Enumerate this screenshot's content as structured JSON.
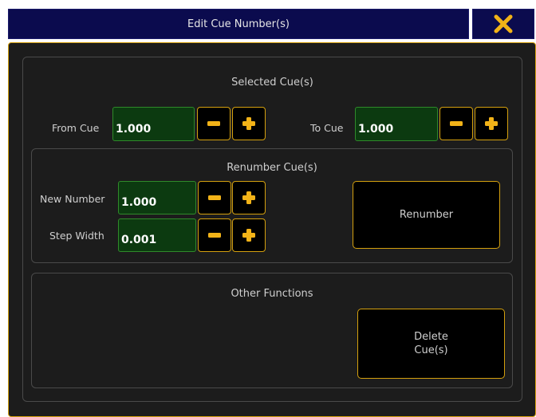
{
  "title": "Edit Cue Number(s)",
  "close_icon": "close-x-icon",
  "colors": {
    "title_bar": "#0b0b4e",
    "dialog_bg": "#1c1c1c",
    "accent": "#d4a00e",
    "field_bg": "#0c3a10",
    "field_border": "#2f8a2a"
  },
  "selected": {
    "title": "Selected Cue(s)",
    "from_label": "From Cue",
    "from_value": "1.000",
    "to_label": "To Cue",
    "to_value": "1.000"
  },
  "renumber": {
    "title": "Renumber Cue(s)",
    "new_number_label": "New Number",
    "new_number_value": "1.000",
    "step_width_label": "Step Width",
    "step_width_value": "0.001",
    "button_label": "Renumber"
  },
  "other": {
    "title": "Other Functions",
    "delete_line1": "Delete",
    "delete_line2": "Cue(s)"
  },
  "icons": {
    "minus": "minus-icon",
    "plus": "plus-icon"
  }
}
